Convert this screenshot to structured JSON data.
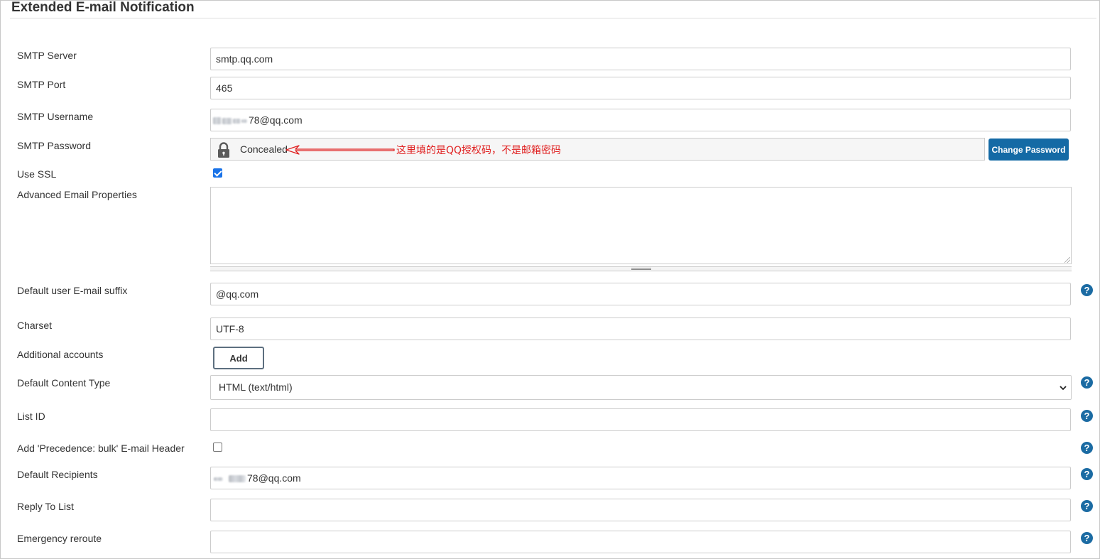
{
  "section": {
    "title": "Extended E-mail Notification"
  },
  "fields": {
    "smtp_server": {
      "label": "SMTP Server",
      "value": "smtp.qq.com"
    },
    "smtp_port": {
      "label": "SMTP Port",
      "value": "465"
    },
    "smtp_username": {
      "label": "SMTP Username",
      "value_visible": "78@qq.com"
    },
    "smtp_password": {
      "label": "SMTP Password",
      "value": "Concealed",
      "button": "Change Password"
    },
    "use_ssl": {
      "label": "Use SSL",
      "checked": true
    },
    "advanced_props": {
      "label": "Advanced Email Properties",
      "value": ""
    },
    "default_suffix": {
      "label": "Default user E-mail suffix",
      "value": "@qq.com"
    },
    "charset": {
      "label": "Charset",
      "value": "UTF-8"
    },
    "additional_accounts": {
      "label": "Additional accounts",
      "button": "Add"
    },
    "content_type": {
      "label": "Default Content Type",
      "selected": "HTML (text/html)"
    },
    "list_id": {
      "label": "List ID",
      "value": ""
    },
    "precedence_bulk": {
      "label": "Add 'Precedence: bulk' E-mail Header",
      "checked": false
    },
    "default_recipients": {
      "label": "Default Recipients",
      "value_visible": "78@qq.com"
    },
    "reply_to": {
      "label": "Reply To List",
      "value": ""
    },
    "emergency_reroute": {
      "label": "Emergency reroute",
      "value": ""
    }
  },
  "annotation": {
    "text": "这里填的是QQ授权码，不是邮箱密码",
    "color": "#e02020"
  },
  "icons": {
    "help": "help-icon",
    "lock": "lock-icon",
    "select_arrow": "chevron-down-icon"
  },
  "help_glyph": "?",
  "colors": {
    "primary_button": "#146aa5",
    "help_icon": "#1b6ba3",
    "checkbox_on": "#1a73e8"
  }
}
